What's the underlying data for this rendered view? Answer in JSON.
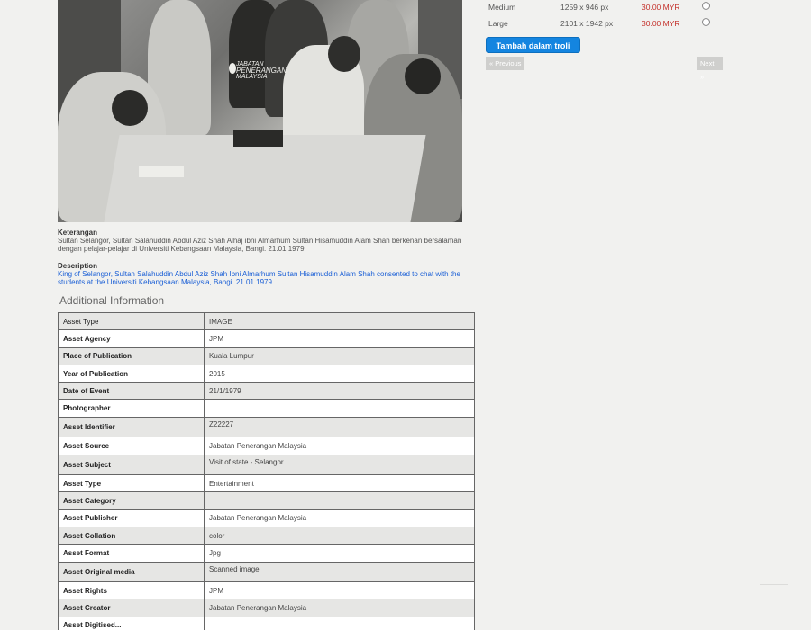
{
  "photo": {
    "watermark_line1": "JABATAN",
    "watermark_line2": "PENERANGAN",
    "watermark_line3": "MALAYSIA"
  },
  "captions": {
    "keterangan_label": "Keterangan",
    "keterangan_text": "Sultan Selangor, Sultan Salahuddin Abdul Aziz Shah Alhaj ibni Almarhum Sultan Hisamuddin Alam Shah berkenan bersalaman dengan pelajar-pelajar di Universiti Kebangsaan Malaysia, Bangi. 21.01.1979",
    "description_label": "Description",
    "description_text": "King of Selangor, Sultan Salahuddin Abdul Aziz Shah Ibni Almarhum Sultan Hisamuddin Alam Shah consented to chat with the students at the Universiti Kebangsaan Malaysia, Bangi. 21.01.1979"
  },
  "additional": {
    "title": "Additional Information",
    "rows": [
      {
        "k": "Asset Type",
        "v": "IMAGE"
      },
      {
        "k": "Asset Agency",
        "v": "JPM"
      },
      {
        "k": "Place of Publication",
        "v": "Kuala Lumpur"
      },
      {
        "k": "Year of Publication",
        "v": "2015"
      },
      {
        "k": "Date of Event",
        "v": "21/1/1979"
      },
      {
        "k": "Photographer",
        "v": ""
      },
      {
        "k": "Asset Identifier",
        "v": "Z22227"
      },
      {
        "k": "Asset Source",
        "v": "Jabatan Penerangan Malaysia"
      },
      {
        "k": "Asset Subject",
        "v": "Visit of state - Selangor"
      },
      {
        "k": "Asset Type",
        "v": "Entertainment"
      },
      {
        "k": "Asset Category",
        "v": ""
      },
      {
        "k": "Asset Publisher",
        "v": "Jabatan Penerangan Malaysia"
      },
      {
        "k": "Asset Collation",
        "v": "color"
      },
      {
        "k": "Asset Format",
        "v": "Jpg"
      },
      {
        "k": "Asset Original media",
        "v": "Scanned image"
      },
      {
        "k": "Asset Rights",
        "v": "JPM"
      },
      {
        "k": "Asset Creator",
        "v": "Jabatan Penerangan Malaysia"
      },
      {
        "k": "Asset Digitised...",
        "v": ""
      }
    ]
  },
  "sizes": [
    {
      "name": "Medium",
      "dim": "1259 x 946 px",
      "price": "30.00 MYR"
    },
    {
      "name": "Large",
      "dim": "2101 x 1942 px",
      "price": "30.00 MYR"
    }
  ],
  "cart": {
    "add_label": "Tambah dalam troli"
  },
  "pager": {
    "prev_label": "« Previous",
    "next_label": "Next »"
  },
  "colors": {
    "accent": "#1485e0",
    "price": "#c4312b",
    "link": "#1a5fd6"
  }
}
